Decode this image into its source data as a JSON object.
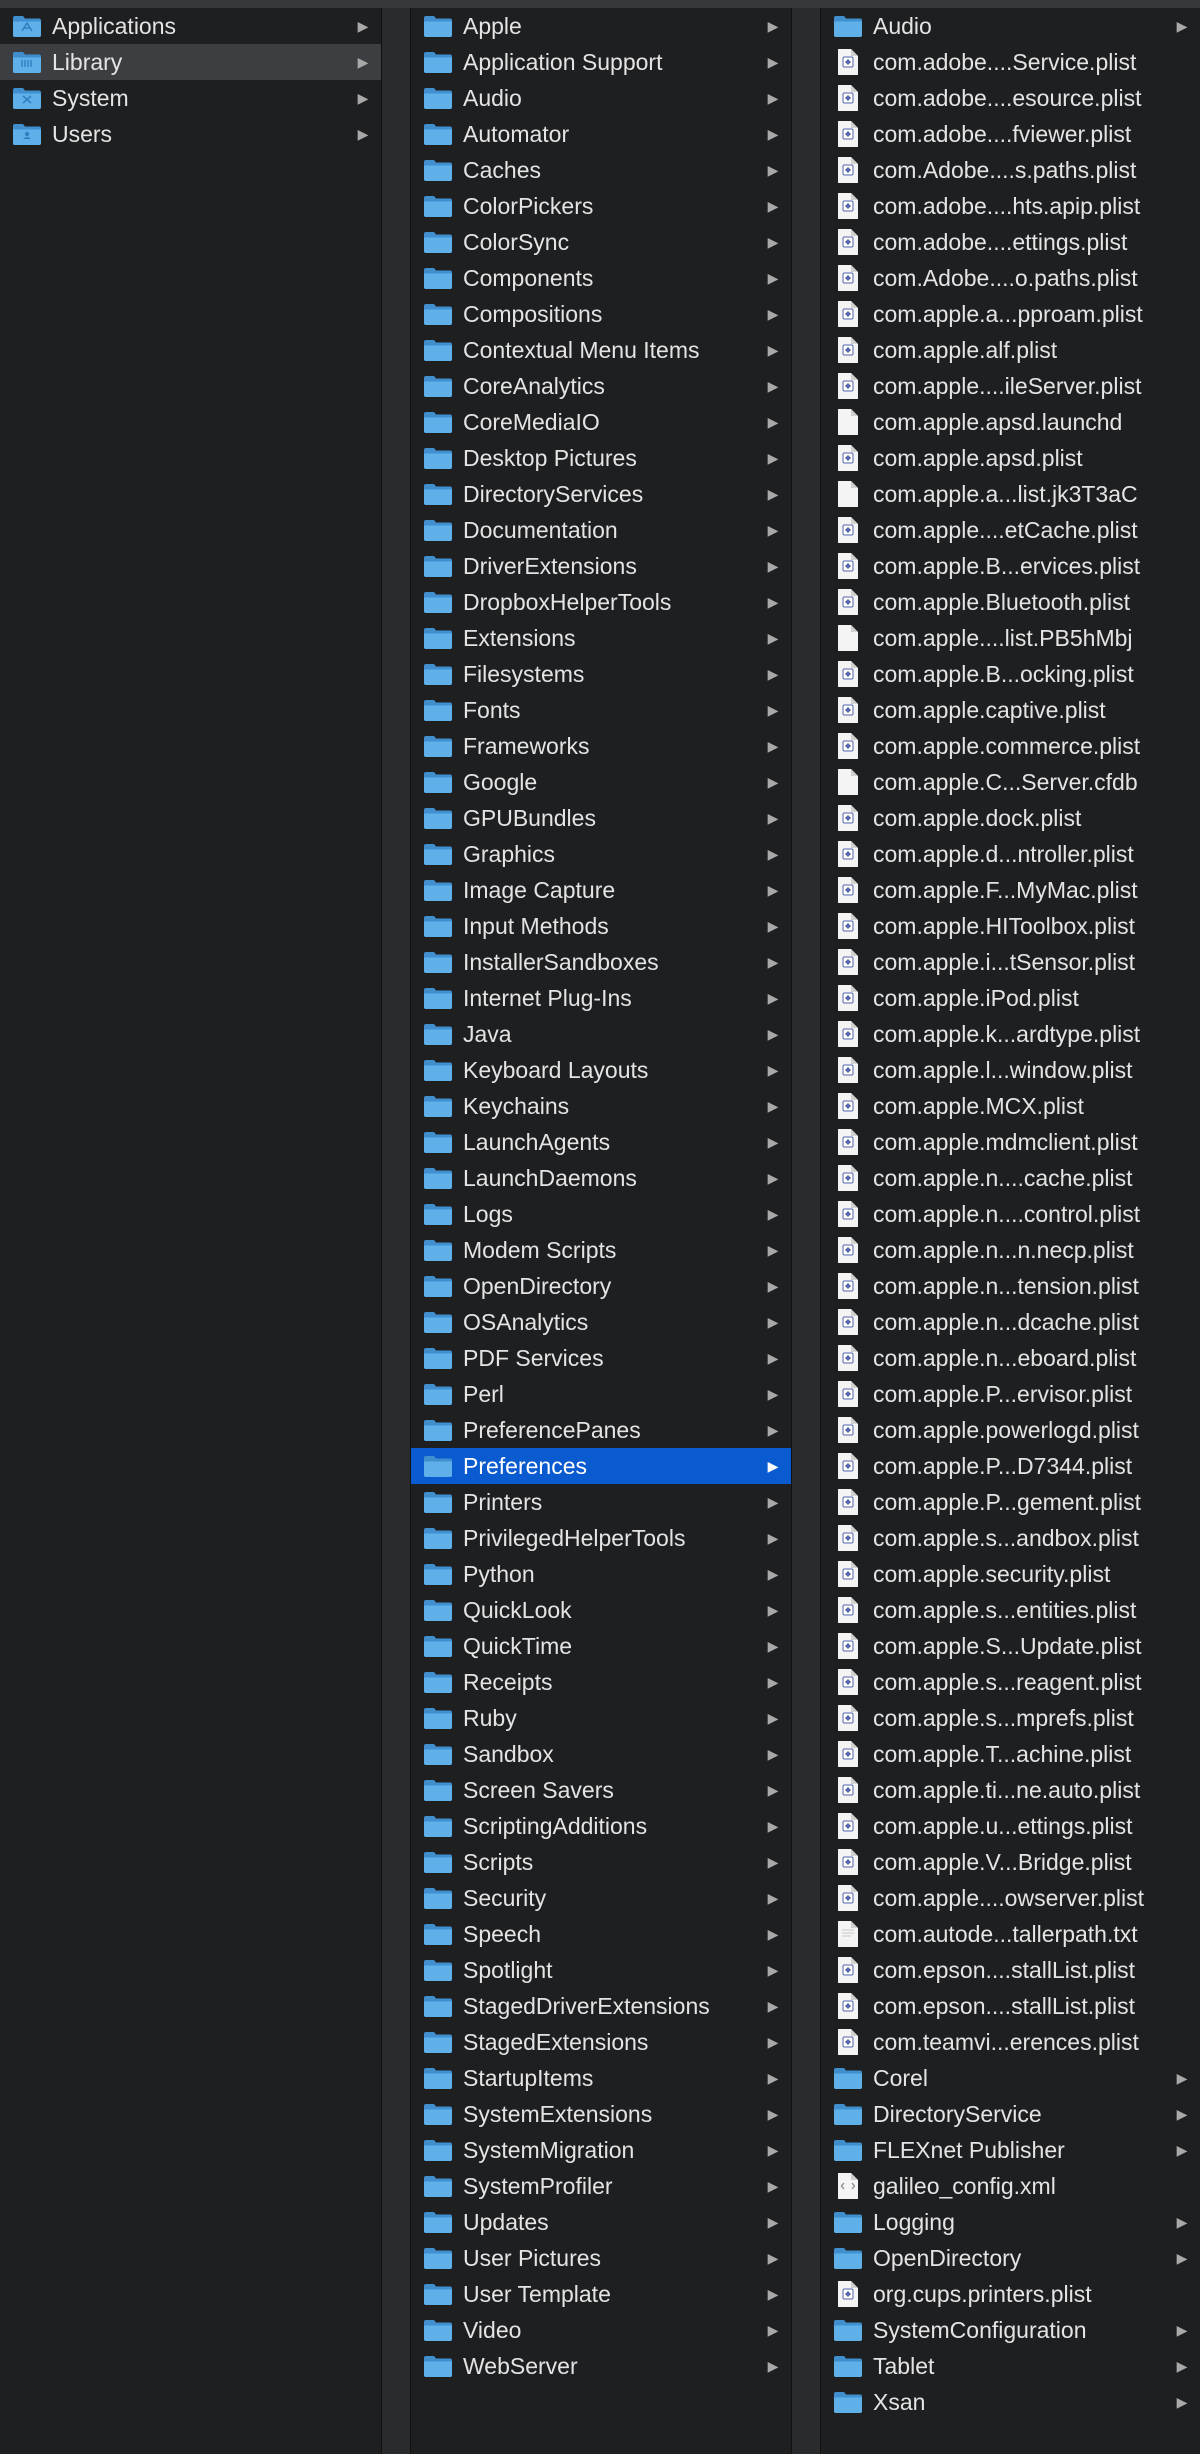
{
  "columns": [
    {
      "items": [
        {
          "label": "Applications",
          "kind": "folder",
          "icon": "applications-folder-icon",
          "arrow": true,
          "state": ""
        },
        {
          "label": "Library",
          "kind": "folder",
          "icon": "library-folder-icon",
          "arrow": true,
          "state": "inactive"
        },
        {
          "label": "System",
          "kind": "folder",
          "icon": "system-folder-icon",
          "arrow": true,
          "state": ""
        },
        {
          "label": "Users",
          "kind": "folder",
          "icon": "users-folder-icon",
          "arrow": true,
          "state": ""
        }
      ]
    },
    {
      "items": [
        {
          "label": "Apple",
          "kind": "folder",
          "arrow": true
        },
        {
          "label": "Application Support",
          "kind": "folder",
          "arrow": true
        },
        {
          "label": "Audio",
          "kind": "folder",
          "arrow": true
        },
        {
          "label": "Automator",
          "kind": "folder",
          "arrow": true
        },
        {
          "label": "Caches",
          "kind": "folder",
          "arrow": true
        },
        {
          "label": "ColorPickers",
          "kind": "folder",
          "arrow": true
        },
        {
          "label": "ColorSync",
          "kind": "folder",
          "arrow": true
        },
        {
          "label": "Components",
          "kind": "folder",
          "arrow": true
        },
        {
          "label": "Compositions",
          "kind": "folder",
          "arrow": true
        },
        {
          "label": "Contextual Menu Items",
          "kind": "folder",
          "arrow": true
        },
        {
          "label": "CoreAnalytics",
          "kind": "folder",
          "arrow": true
        },
        {
          "label": "CoreMediaIO",
          "kind": "folder",
          "arrow": true
        },
        {
          "label": "Desktop Pictures",
          "kind": "folder",
          "arrow": true
        },
        {
          "label": "DirectoryServices",
          "kind": "folder",
          "arrow": true
        },
        {
          "label": "Documentation",
          "kind": "folder",
          "arrow": true
        },
        {
          "label": "DriverExtensions",
          "kind": "folder",
          "arrow": true
        },
        {
          "label": "DropboxHelperTools",
          "kind": "folder",
          "arrow": true
        },
        {
          "label": "Extensions",
          "kind": "folder",
          "arrow": true
        },
        {
          "label": "Filesystems",
          "kind": "folder",
          "arrow": true
        },
        {
          "label": "Fonts",
          "kind": "folder",
          "arrow": true
        },
        {
          "label": "Frameworks",
          "kind": "folder",
          "arrow": true
        },
        {
          "label": "Google",
          "kind": "folder",
          "arrow": true
        },
        {
          "label": "GPUBundles",
          "kind": "folder",
          "arrow": true
        },
        {
          "label": "Graphics",
          "kind": "folder",
          "arrow": true
        },
        {
          "label": "Image Capture",
          "kind": "folder",
          "arrow": true
        },
        {
          "label": "Input Methods",
          "kind": "folder",
          "arrow": true
        },
        {
          "label": "InstallerSandboxes",
          "kind": "folder",
          "arrow": true
        },
        {
          "label": "Internet Plug-Ins",
          "kind": "folder",
          "arrow": true
        },
        {
          "label": "Java",
          "kind": "folder",
          "arrow": true
        },
        {
          "label": "Keyboard Layouts",
          "kind": "folder",
          "arrow": true
        },
        {
          "label": "Keychains",
          "kind": "folder",
          "arrow": true
        },
        {
          "label": "LaunchAgents",
          "kind": "folder",
          "arrow": true
        },
        {
          "label": "LaunchDaemons",
          "kind": "folder",
          "arrow": true
        },
        {
          "label": "Logs",
          "kind": "folder",
          "arrow": true
        },
        {
          "label": "Modem Scripts",
          "kind": "folder",
          "arrow": true
        },
        {
          "label": "OpenDirectory",
          "kind": "folder",
          "arrow": true
        },
        {
          "label": "OSAnalytics",
          "kind": "folder",
          "arrow": true
        },
        {
          "label": "PDF Services",
          "kind": "folder",
          "arrow": true
        },
        {
          "label": "Perl",
          "kind": "folder",
          "arrow": true
        },
        {
          "label": "PreferencePanes",
          "kind": "folder",
          "arrow": true
        },
        {
          "label": "Preferences",
          "kind": "folder",
          "arrow": true,
          "state": "active"
        },
        {
          "label": "Printers",
          "kind": "folder",
          "arrow": true
        },
        {
          "label": "PrivilegedHelperTools",
          "kind": "folder",
          "arrow": true
        },
        {
          "label": "Python",
          "kind": "folder",
          "arrow": true
        },
        {
          "label": "QuickLook",
          "kind": "folder",
          "arrow": true
        },
        {
          "label": "QuickTime",
          "kind": "folder",
          "arrow": true
        },
        {
          "label": "Receipts",
          "kind": "folder",
          "arrow": true
        },
        {
          "label": "Ruby",
          "kind": "folder",
          "arrow": true
        },
        {
          "label": "Sandbox",
          "kind": "folder",
          "arrow": true
        },
        {
          "label": "Screen Savers",
          "kind": "folder",
          "arrow": true
        },
        {
          "label": "ScriptingAdditions",
          "kind": "folder",
          "arrow": true
        },
        {
          "label": "Scripts",
          "kind": "folder",
          "arrow": true
        },
        {
          "label": "Security",
          "kind": "folder",
          "arrow": true
        },
        {
          "label": "Speech",
          "kind": "folder",
          "arrow": true
        },
        {
          "label": "Spotlight",
          "kind": "folder",
          "arrow": true
        },
        {
          "label": "StagedDriverExtensions",
          "kind": "folder",
          "arrow": true
        },
        {
          "label": "StagedExtensions",
          "kind": "folder",
          "arrow": true
        },
        {
          "label": "StartupItems",
          "kind": "folder",
          "arrow": true
        },
        {
          "label": "SystemExtensions",
          "kind": "folder",
          "arrow": true
        },
        {
          "label": "SystemMigration",
          "kind": "folder",
          "arrow": true
        },
        {
          "label": "SystemProfiler",
          "kind": "folder",
          "arrow": true
        },
        {
          "label": "Updates",
          "kind": "folder",
          "arrow": true
        },
        {
          "label": "User Pictures",
          "kind": "folder",
          "arrow": true
        },
        {
          "label": "User Template",
          "kind": "folder",
          "arrow": true
        },
        {
          "label": "Video",
          "kind": "folder",
          "arrow": true
        },
        {
          "label": "WebServer",
          "kind": "folder",
          "arrow": true
        }
      ]
    },
    {
      "items": [
        {
          "label": "Audio",
          "kind": "folder",
          "arrow": true
        },
        {
          "label": "com.adobe....Service.plist",
          "kind": "plist"
        },
        {
          "label": "com.adobe....esource.plist",
          "kind": "plist"
        },
        {
          "label": "com.adobe....fviewer.plist",
          "kind": "plist"
        },
        {
          "label": "com.Adobe....s.paths.plist",
          "kind": "plist"
        },
        {
          "label": "com.adobe....hts.apip.plist",
          "kind": "plist"
        },
        {
          "label": "com.adobe....ettings.plist",
          "kind": "plist"
        },
        {
          "label": "com.Adobe....o.paths.plist",
          "kind": "plist"
        },
        {
          "label": "com.apple.a...pproam.plist",
          "kind": "plist"
        },
        {
          "label": "com.apple.alf.plist",
          "kind": "plist"
        },
        {
          "label": "com.apple....ileServer.plist",
          "kind": "plist"
        },
        {
          "label": "com.apple.apsd.launchd",
          "kind": "file"
        },
        {
          "label": "com.apple.apsd.plist",
          "kind": "plist"
        },
        {
          "label": "com.apple.a...list.jk3T3aC",
          "kind": "file"
        },
        {
          "label": "com.apple....etCache.plist",
          "kind": "plist"
        },
        {
          "label": "com.apple.B...ervices.plist",
          "kind": "plist"
        },
        {
          "label": "com.apple.Bluetooth.plist",
          "kind": "plist"
        },
        {
          "label": "com.apple....list.PB5hMbj",
          "kind": "file"
        },
        {
          "label": "com.apple.B...ocking.plist",
          "kind": "plist"
        },
        {
          "label": "com.apple.captive.plist",
          "kind": "plist"
        },
        {
          "label": "com.apple.commerce.plist",
          "kind": "plist"
        },
        {
          "label": "com.apple.C...Server.cfdb",
          "kind": "file"
        },
        {
          "label": "com.apple.dock.plist",
          "kind": "plist"
        },
        {
          "label": "com.apple.d...ntroller.plist",
          "kind": "plist"
        },
        {
          "label": "com.apple.F...MyMac.plist",
          "kind": "plist"
        },
        {
          "label": "com.apple.HIToolbox.plist",
          "kind": "plist"
        },
        {
          "label": "com.apple.i...tSensor.plist",
          "kind": "plist"
        },
        {
          "label": "com.apple.iPod.plist",
          "kind": "plist"
        },
        {
          "label": "com.apple.k...ardtype.plist",
          "kind": "plist"
        },
        {
          "label": "com.apple.l...window.plist",
          "kind": "plist"
        },
        {
          "label": "com.apple.MCX.plist",
          "kind": "plist"
        },
        {
          "label": "com.apple.mdmclient.plist",
          "kind": "plist"
        },
        {
          "label": "com.apple.n....cache.plist",
          "kind": "plist"
        },
        {
          "label": "com.apple.n....control.plist",
          "kind": "plist"
        },
        {
          "label": "com.apple.n...n.necp.plist",
          "kind": "plist"
        },
        {
          "label": "com.apple.n...tension.plist",
          "kind": "plist"
        },
        {
          "label": "com.apple.n...dcache.plist",
          "kind": "plist"
        },
        {
          "label": "com.apple.n...eboard.plist",
          "kind": "plist"
        },
        {
          "label": "com.apple.P...ervisor.plist",
          "kind": "plist"
        },
        {
          "label": "com.apple.powerlogd.plist",
          "kind": "plist"
        },
        {
          "label": "com.apple.P...D7344.plist",
          "kind": "plist"
        },
        {
          "label": "com.apple.P...gement.plist",
          "kind": "plist"
        },
        {
          "label": "com.apple.s...andbox.plist",
          "kind": "plist"
        },
        {
          "label": "com.apple.security.plist",
          "kind": "plist"
        },
        {
          "label": "com.apple.s...entities.plist",
          "kind": "plist"
        },
        {
          "label": "com.apple.S...Update.plist",
          "kind": "plist"
        },
        {
          "label": "com.apple.s...reagent.plist",
          "kind": "plist"
        },
        {
          "label": "com.apple.s...mprefs.plist",
          "kind": "plist"
        },
        {
          "label": "com.apple.T...achine.plist",
          "kind": "plist"
        },
        {
          "label": "com.apple.ti...ne.auto.plist",
          "kind": "plist"
        },
        {
          "label": "com.apple.u...ettings.plist",
          "kind": "plist"
        },
        {
          "label": "com.apple.V...Bridge.plist",
          "kind": "plist"
        },
        {
          "label": "com.apple....owserver.plist",
          "kind": "plist"
        },
        {
          "label": "com.autode...tallerpath.txt",
          "kind": "text"
        },
        {
          "label": "com.epson....stallList.plist",
          "kind": "plist"
        },
        {
          "label": "com.epson....stallList.plist",
          "kind": "plist"
        },
        {
          "label": "com.teamvi...erences.plist",
          "kind": "plist"
        },
        {
          "label": "Corel",
          "kind": "folder",
          "arrow": true
        },
        {
          "label": "DirectoryService",
          "kind": "folder",
          "arrow": true
        },
        {
          "label": "FLEXnet Publisher",
          "kind": "folder",
          "arrow": true
        },
        {
          "label": "galileo_config.xml",
          "kind": "xml"
        },
        {
          "label": "Logging",
          "kind": "folder",
          "arrow": true
        },
        {
          "label": "OpenDirectory",
          "kind": "folder",
          "arrow": true
        },
        {
          "label": "org.cups.printers.plist",
          "kind": "plist"
        },
        {
          "label": "SystemConfiguration",
          "kind": "folder",
          "arrow": true
        },
        {
          "label": "Tablet",
          "kind": "folder",
          "arrow": true
        },
        {
          "label": "Xsan",
          "kind": "folder",
          "arrow": true
        }
      ]
    }
  ],
  "arrow_glyph": "▶",
  "colors": {
    "selection_active": "#0a5bd0",
    "selection_inactive": "#3d3e41",
    "folder": "#5fb0e8",
    "background": "#1e1f21"
  }
}
